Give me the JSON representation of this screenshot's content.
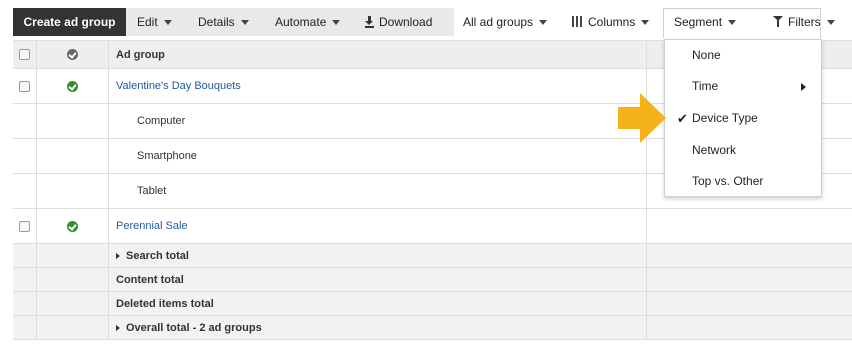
{
  "toolbar": {
    "create_label": "Create ad group",
    "edit_label": "Edit",
    "details_label": "Details",
    "automate_label": "Automate",
    "download_label": "Download",
    "all_ad_groups_label": "All ad groups",
    "columns_label": "Columns",
    "segment_label": "Segment",
    "filters_label": "Filters"
  },
  "table": {
    "header": {
      "name": "Ad group"
    },
    "rows": [
      {
        "name": "Valentine's Day Bouquets"
      },
      {
        "name": "Computer"
      },
      {
        "name": "Smartphone"
      },
      {
        "name": "Tablet"
      },
      {
        "name": "Perennial Sale"
      }
    ],
    "totals": [
      {
        "label": "Search total"
      },
      {
        "label": "Content total"
      },
      {
        "label": "Deleted items total"
      },
      {
        "label": "Overall total - 2 ad groups"
      }
    ]
  },
  "segment_menu": {
    "items": [
      {
        "label": "None"
      },
      {
        "label": "Time"
      },
      {
        "label": "Device Type"
      },
      {
        "label": "Network"
      },
      {
        "label": "Top vs. Other"
      }
    ],
    "selected": "Device Type"
  },
  "colors": {
    "accent_pointer": "#f6b21b",
    "link": "#1f5b9d",
    "status_enabled": "#2f8f2f",
    "toolbar_primary": "#333333"
  },
  "icons": {
    "download": "download-icon",
    "columns": "columns-icon",
    "filters": "funnel-icon",
    "checkmark": "check-icon"
  }
}
